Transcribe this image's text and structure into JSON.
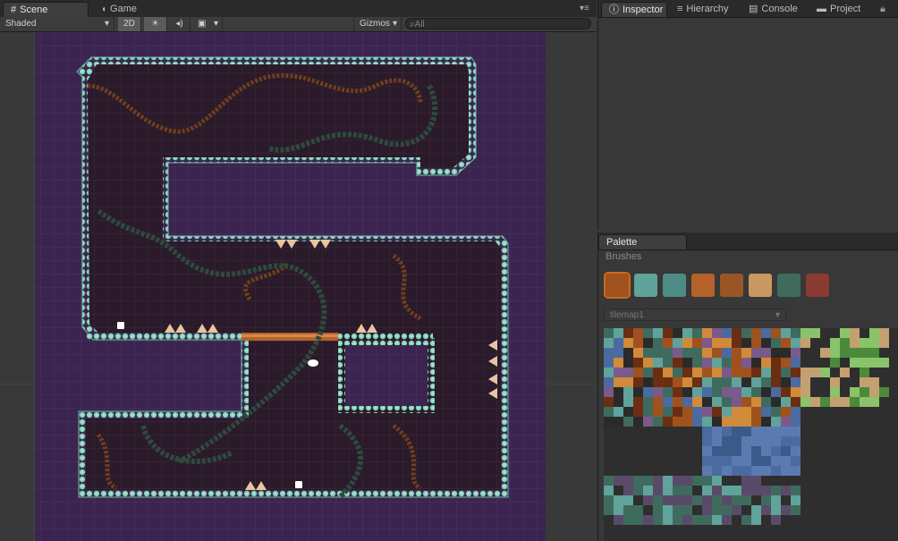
{
  "scene_window": {
    "tabs": [
      {
        "label": "Scene",
        "icon": "grid-icon",
        "active": true
      },
      {
        "label": "Game",
        "icon": "pacman-icon",
        "active": false
      }
    ],
    "toolbar": {
      "render_mode": "Shaded",
      "mode_2d": "2D",
      "lighting_icon": "sun-icon",
      "audio_icon": "speaker-icon",
      "fx_icon": "image-icon",
      "gizmos": "Gizmos",
      "search_placeholder": "All",
      "search_icon": "search-icon"
    },
    "menu_icon": "menu-icon"
  },
  "right_tabs": [
    {
      "label": "Inspector",
      "icon": "info-icon",
      "active": true
    },
    {
      "label": "Hierarchy",
      "icon": "list-icon",
      "active": false
    },
    {
      "label": "Console",
      "icon": "console-icon",
      "active": false
    },
    {
      "label": "Project",
      "icon": "folder-icon",
      "active": false
    }
  ],
  "palette": {
    "tab_label": "Palette",
    "section_label": "Brushes",
    "brushes": [
      {
        "name": "crate-brush",
        "color": "#a0521e"
      },
      {
        "name": "teal-block-brush",
        "color": "#5fa39a"
      },
      {
        "name": "teal-ring-brush",
        "color": "#4d8c86"
      },
      {
        "name": "orange-ring-brush",
        "color": "#b4622a"
      },
      {
        "name": "orange-round-brush",
        "color": "#9a5526"
      },
      {
        "name": "cross-brush",
        "color": "#c99860"
      },
      {
        "name": "character-brush",
        "color": "#3f6b5e"
      },
      {
        "name": "signpost-brush",
        "color": "#8a3b32"
      }
    ],
    "tilemap_select": "tilemap1"
  },
  "colors": {
    "level_bg": "#2a1a2a",
    "outer_bg": "#3c2450",
    "border": "#7fd0b5",
    "brush_highlight": "#c96a1a"
  }
}
